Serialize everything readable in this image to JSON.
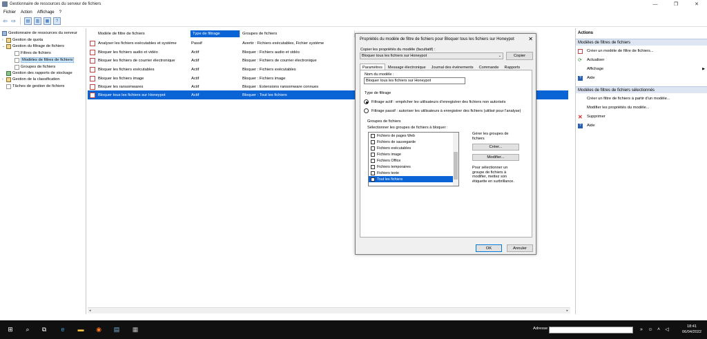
{
  "window": {
    "title": "Gestionnaire de ressources du serveur de fichiers",
    "controls": [
      "—",
      "❐",
      "✕"
    ]
  },
  "menu": [
    "Fichier",
    "Action",
    "Affichage",
    "?"
  ],
  "tree": [
    {
      "label": "Gestionnaire de ressources du serveur",
      "icon": "server-icon"
    },
    {
      "label": "Gestion de quota",
      "icon": "folder-icon"
    },
    {
      "label": "Gestion du filtrage de fichiers",
      "icon": "folder-icon"
    },
    {
      "label": "Filtres de fichiers",
      "icon": "doc-icon"
    },
    {
      "label": "Modèles de filtres de fichiers",
      "icon": "doc-icon"
    },
    {
      "label": "Groupes de fichiers",
      "icon": "doc-icon"
    },
    {
      "label": "Gestion des rapports de stockage",
      "icon": "report-icon"
    },
    {
      "label": "Gestion de la classification",
      "icon": "folder-icon"
    },
    {
      "label": "Tâches de gestion de fichiers",
      "icon": "doc-icon"
    }
  ],
  "list": {
    "headers": [
      "Modèle de filtre de fichiers",
      "Type de filtrage",
      "Groupes de fichiers"
    ],
    "rows": [
      [
        "Analyser les fichiers exécutables et système",
        "Passif",
        "Avertir : Fichiers exécutables, Fichier système"
      ],
      [
        "Bloquer les fichiers audio et vidéo",
        "Actif",
        "Bloquer : Fichiers audio et vidéo"
      ],
      [
        "Bloquer les fichiers de courrier électronique",
        "Actif",
        "Bloquer : Fichiers de courrier électronique"
      ],
      [
        "Bloquer les fichiers exécutables",
        "Actif",
        "Bloquer : Fichiers exécutables"
      ],
      [
        "Bloquer les fichiers image",
        "Actif",
        "Bloquer : Fichiers image"
      ],
      [
        "Bloquer les ransomwares",
        "Actif",
        "Bloquer : Extensions ransomware connues"
      ],
      [
        "Bloquer tous les fichiers sur Honeypot",
        "Actif",
        "Bloquer : Tout les fichiers"
      ]
    ]
  },
  "actions": {
    "title": "Actions",
    "section1": "Modèles de filtres de fichiers",
    "items1": [
      "Créer un modèle de filtre de fichiers...",
      "Actualiser",
      "Affichage",
      "Aide"
    ],
    "section2": "Modèles de filtres de fichiers sélectionnés",
    "items2": [
      "Créer un filtre de fichiers à partir d'un modèle...",
      "Modifier les propriétés du modèle...",
      "Supprimer",
      "Aide"
    ]
  },
  "dialog": {
    "title": "Propriétés du modèle de filtre de fichiers pour Bloquer tous les fichiers sur Honeypot",
    "close": "✕",
    "copy_label": "Copier les propriétés du modèle (facultatif) :",
    "copy_value": "Bloquer tous les fichiers sur Honeypot",
    "copy_button": "Copier",
    "tabs": [
      "Paramètres",
      "Message électronique",
      "Journal des événements",
      "Commande",
      "Rapports"
    ],
    "name_label": "Nom du modèle :",
    "name_value": "Bloquer tous les fichiers sur Honeypot",
    "filter_type_label": "Type de filtrage",
    "active_option": "Filtrage actif : empêcher les utilisateurs d'enregistrer des fichiers non autorisés",
    "passive_option": "Filtrage passif : autoriser les utilisateurs à enregistrer des fichiers (utilisé pour l'analyse)",
    "groups_label": "Groupes de fichiers",
    "groups_select_label": "Sélectionner les groupes de fichiers à bloquer :",
    "groups": [
      {
        "label": "Fichiers de pages Web",
        "checked": false
      },
      {
        "label": "Fichiers de sauvegarde",
        "checked": false
      },
      {
        "label": "Fichiers exécutables",
        "checked": false
      },
      {
        "label": "Fichiers image",
        "checked": false
      },
      {
        "label": "Fichiers Office",
        "checked": false
      },
      {
        "label": "Fichiers temporaires",
        "checked": false
      },
      {
        "label": "Fichiers texte",
        "checked": false
      },
      {
        "label": "Tout les fichiers",
        "checked": true
      }
    ],
    "manage_label": "Gérer les groupes de fichiers",
    "create_button": "Créer...",
    "modify_button": "Modifier...",
    "hint": "Pour sélectionner un groupe de fichiers à modifier, mettez son étiquette en surbrillance.",
    "ok_button": "OK",
    "cancel_button": "Annuler"
  },
  "taskbar": {
    "address_label": "Adresse",
    "time": "18:41",
    "date": "06/04/2022"
  },
  "colors": {
    "selection": "#0a64d6",
    "action_section": "#dde6f2"
  }
}
